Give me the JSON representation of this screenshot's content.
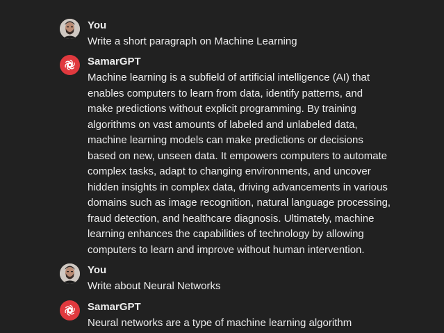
{
  "messages": [
    {
      "author": "You",
      "role": "user",
      "lines": [
        "Write a short paragraph on Machine Learning"
      ]
    },
    {
      "author": "SamarGPT",
      "role": "assistant",
      "lines": [
        "Machine learning is a subfield of artificial intelligence (AI) that",
        "enables computers to learn from data, identify patterns, and",
        "make predictions without explicit programming. By training",
        "algorithms on vast amounts of labeled and unlabeled data,",
        "machine learning models can make predictions or decisions",
        "based on new, unseen data. It empowers computers to automate",
        "complex tasks, adapt to changing environments, and uncover",
        "hidden insights in complex data, driving advancements in various",
        "domains such as image recognition, natural language processing,",
        "fraud detection, and healthcare diagnosis. Ultimately, machine",
        "learning enhances the capabilities of technology by allowing",
        "computers to learn and improve without human intervention."
      ]
    },
    {
      "author": "You",
      "role": "user",
      "lines": [
        "Write about Neural Networks"
      ]
    },
    {
      "author": "SamarGPT",
      "role": "assistant",
      "lines": [
        "Neural networks are a type of machine learning algorithm"
      ]
    }
  ],
  "icons": {
    "user_avatar": "user-avatar-photo",
    "bot_avatar": "openai-logo-icon"
  },
  "colors": {
    "background": "#212121",
    "text": "#ececec",
    "bot_avatar": "#e0393e"
  }
}
